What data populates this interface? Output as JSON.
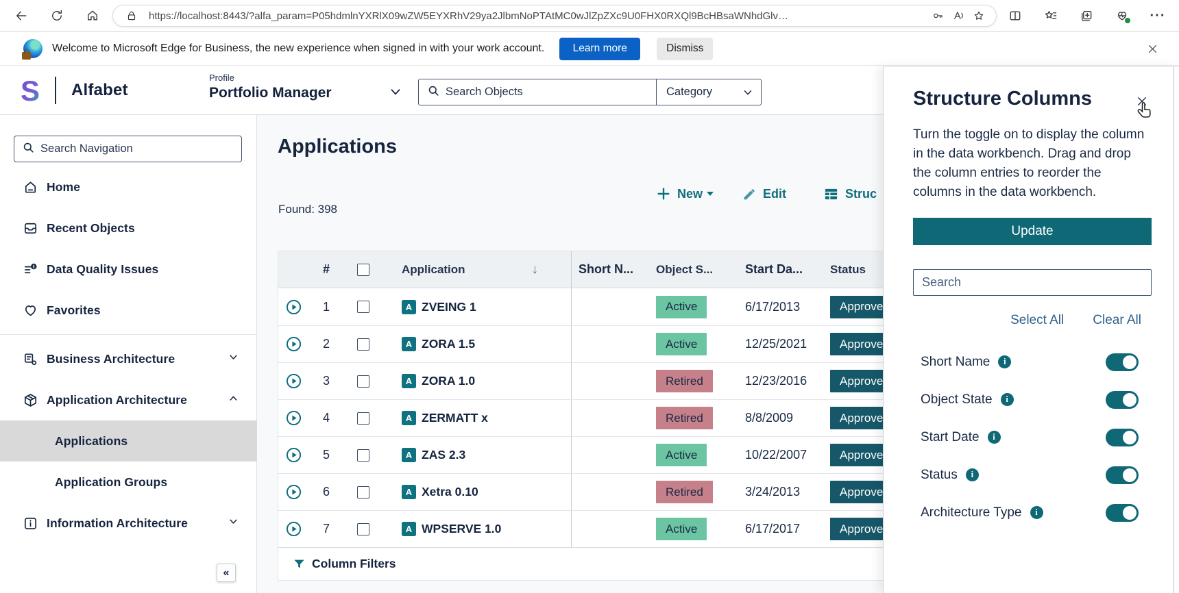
{
  "browser": {
    "url": "https://localhost:8443/?alfa_param=P05hdmlnYXRlX09wZW5EYXRhV29ya2JlbmNoPTAtMC0wJlZpZXc9U0FHX0RXQl9BcHBsaWNhdGlv…",
    "banner": {
      "text": "Welcome to Microsoft Edge for Business, the new experience when signed in with your work account.",
      "learn_more_label": "Learn more",
      "dismiss_label": "Dismiss"
    }
  },
  "header": {
    "brand": "Alfabet",
    "profile_label": "Profile",
    "profile_value": "Portfolio Manager",
    "search_placeholder": "Search Objects",
    "category_value": "Category"
  },
  "sidebar": {
    "search_placeholder": "Search Navigation",
    "collapse_glyph": "«",
    "items": [
      {
        "label": "Home",
        "icon": "home",
        "level": 0
      },
      {
        "label": "Recent Objects",
        "icon": "recent",
        "level": 0
      },
      {
        "label": "Data Quality Issues",
        "icon": "quality",
        "level": 0
      },
      {
        "label": "Favorites",
        "icon": "heart",
        "level": 0,
        "divider_after": true
      },
      {
        "label": "Business Architecture",
        "icon": "business",
        "level": 0,
        "chevron": "down"
      },
      {
        "label": "Application Architecture",
        "icon": "application",
        "level": 0,
        "chevron": "up"
      },
      {
        "label": "Applications",
        "level": 1,
        "selected": true
      },
      {
        "label": "Application Groups",
        "level": 1
      },
      {
        "label": "Information Architecture",
        "icon": "information",
        "level": 0,
        "chevron": "down"
      }
    ]
  },
  "main": {
    "title": "Applications",
    "found_label": "Found: 398",
    "toolbar": {
      "new_label": "New",
      "edit_label": "Edit",
      "structure_label": "Struc"
    },
    "table": {
      "columns": {
        "num": "#",
        "application": "Application",
        "short_name": "Short N...",
        "object_state": "Object S...",
        "start_date": "Start Da...",
        "status": "Status"
      },
      "rows": [
        {
          "num": "1",
          "application": "ZVEING 1",
          "short_name": "",
          "object_state": "Active",
          "start_date": "6/17/2013",
          "status": "Approve"
        },
        {
          "num": "2",
          "application": "ZORA 1.5",
          "short_name": "",
          "object_state": "Active",
          "start_date": "12/25/2021",
          "status": "Approve"
        },
        {
          "num": "3",
          "application": "ZORA 1.0",
          "short_name": "",
          "object_state": "Retired",
          "start_date": "12/23/2016",
          "status": "Approve"
        },
        {
          "num": "4",
          "application": "ZERMATT x",
          "short_name": "",
          "object_state": "Retired",
          "start_date": "8/8/2009",
          "status": "Approve"
        },
        {
          "num": "5",
          "application": "ZAS 2.3",
          "short_name": "",
          "object_state": "Active",
          "start_date": "10/22/2007",
          "status": "Approve"
        },
        {
          "num": "6",
          "application": "Xetra 0.10",
          "short_name": "",
          "object_state": "Retired",
          "start_date": "3/24/2013",
          "status": "Approve"
        },
        {
          "num": "7",
          "application": "WPSERVE 1.0",
          "short_name": "",
          "object_state": "Active",
          "start_date": "6/17/2017",
          "status": "Approve"
        }
      ]
    },
    "footer_filter_label": "Column Filters"
  },
  "panel": {
    "title": "Structure Columns",
    "description": "Turn the toggle on to display the column in the data workbench. Drag and drop the column entries to reorder the columns in the data workbench.",
    "update_label": "Update",
    "search_placeholder": "Search",
    "select_all_label": "Select All",
    "clear_all_label": "Clear All",
    "toggles": [
      {
        "label": "Short Name",
        "on": true
      },
      {
        "label": "Object State",
        "on": true
      },
      {
        "label": "Start Date",
        "on": true
      },
      {
        "label": "Status",
        "on": true
      },
      {
        "label": "Architecture Type",
        "on": true
      }
    ]
  },
  "colors": {
    "accent_teal": "#0f6e7c",
    "button_teal": "#0e6876",
    "status_badge_teal": "#16586a",
    "active_badge_green": "#6cc5a2",
    "retired_badge_rose": "#c5808a",
    "navy_text": "#1a2944",
    "banner_button_blue": "#0b62c4",
    "link_blue": "#2e608c",
    "selected_item_gray": "#d9d9d9"
  }
}
